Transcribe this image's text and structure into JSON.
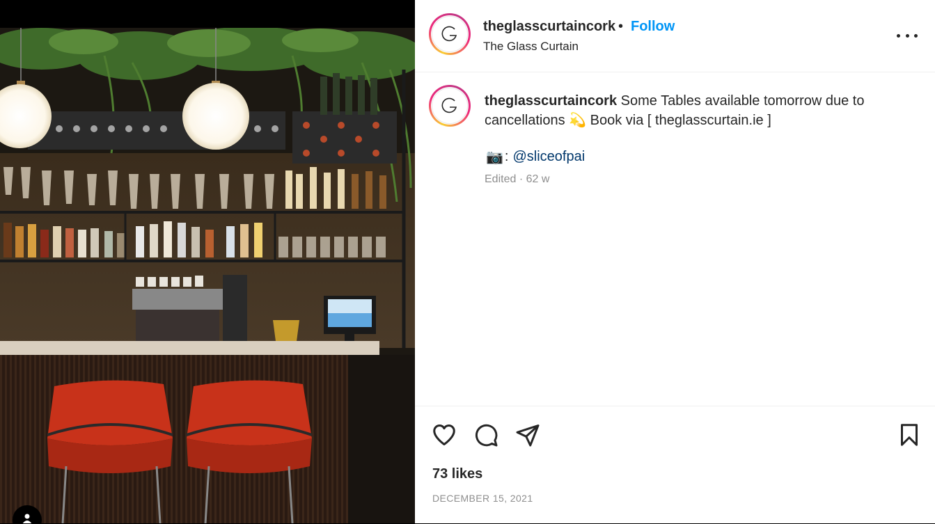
{
  "post": {
    "username": "theglasscurtaincork",
    "separator": "•",
    "follow_label": "Follow",
    "location": "The Glass Curtain",
    "avatar_letter": "G",
    "caption_text": "Some Tables available tomorrow due to cancellations 💫 Book via [ theglasscurtain.ie ]",
    "camera_emoji": "📷",
    "mention_colon": ":",
    "mention": "@sliceofpai",
    "edited_label": "Edited · 62 w",
    "likes": "73 likes",
    "date": "DECEMBER 15, 2021"
  },
  "icons": {
    "more": "more-options-icon",
    "like": "heart-icon",
    "comment": "comment-icon",
    "share": "share-icon",
    "save": "bookmark-icon",
    "user_tag": "user-icon"
  },
  "colors": {
    "follow_blue": "#0095f6",
    "mention_blue": "#00376b",
    "muted": "#8e8e8e",
    "text": "#262626",
    "chair_red": "#c8321a"
  }
}
